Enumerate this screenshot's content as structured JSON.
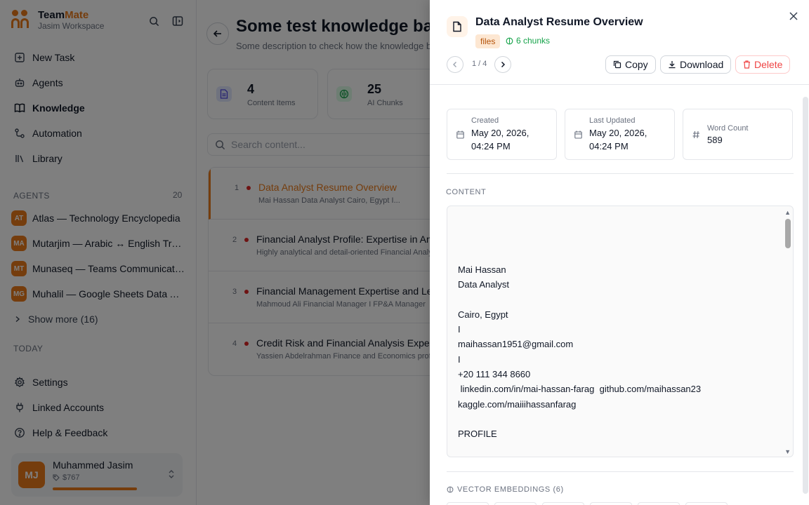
{
  "brand": {
    "name_part1": "Team",
    "name_part2": "Mate",
    "workspace": "Jasim Workspace",
    "accent": "#ea7a1a"
  },
  "nav": [
    {
      "label": "New Task",
      "icon": "new-task-icon"
    },
    {
      "label": "Agents",
      "icon": "agents-icon"
    },
    {
      "label": "Knowledge",
      "icon": "book-icon",
      "active": true
    },
    {
      "label": "Automation",
      "icon": "automation-icon"
    },
    {
      "label": "Library",
      "icon": "library-icon"
    }
  ],
  "agents_section": {
    "label": "AGENTS",
    "count": "20",
    "items": [
      {
        "initials": "AT",
        "name": "Atlas — Technology Encyclopedia"
      },
      {
        "initials": "MA",
        "name": "Mutarjim — Arabic ↔ English Translator"
      },
      {
        "initials": "MT",
        "name": "Munaseq — Teams Communication"
      },
      {
        "initials": "MG",
        "name": "Muhalil — Google Sheets Data Analyst"
      }
    ],
    "show_more": "Show more (16)"
  },
  "today_label": "TODAY",
  "bottom_nav": [
    {
      "label": "Settings",
      "icon": "gear-icon"
    },
    {
      "label": "Linked Accounts",
      "icon": "plug-icon"
    },
    {
      "label": "Help & Feedback",
      "icon": "help-icon"
    }
  ],
  "user": {
    "initials": "MJ",
    "name": "Muhammed Jasim",
    "credit": "$767"
  },
  "page": {
    "title": "Some test knowledge base",
    "description": "Some description to check how the knowledge base"
  },
  "stats": [
    {
      "value": "4",
      "label": "Content Items"
    },
    {
      "value": "25",
      "label": "AI Chunks"
    }
  ],
  "search": {
    "placeholder": "Search content..."
  },
  "items": [
    {
      "num": "1",
      "title": "Data Analyst Resume Overview",
      "sub": "Mai Hassan Data Analyst Cairo, Egypt I..."
    },
    {
      "num": "2",
      "title": "Financial Analyst Profile: Expertise in Analysis",
      "sub": "Highly analytical and detail-oriented Financial Analyst"
    },
    {
      "num": "3",
      "title": "Financial Management Expertise and Leadership",
      "sub": "Mahmoud Ali Financial Manager I FP&A Manager"
    },
    {
      "num": "4",
      "title": "Credit Risk and Financial Analysis Expertise",
      "sub": "Yassien Abdelrahman Finance and Economics professional"
    }
  ],
  "drawer": {
    "title": "Data Analyst Resume Overview",
    "tag": "files",
    "chunks": "6 chunks",
    "pager": "1 / 4",
    "copy": "Copy",
    "download": "Download",
    "delete": "Delete",
    "created_label": "Created",
    "created_value": "May 20, 2026, 04:24 PM",
    "updated_label": "Last Updated",
    "updated_value": "May 20, 2026, 04:24 PM",
    "wordcount_label": "Word Count",
    "wordcount_value": "589",
    "content_label": "CONTENT",
    "content_lines": [
      "Mai Hassan",
      "Data Analyst",
      "",
      "Cairo, Egypt",
      "I",
      "maihassan1951@gmail.com",
      "I",
      "+20 111 344 8660",
      " linkedin.com/in/mai-hassan-farag  github.com/maihassan23",
      "kaggle.com/maiiihassanfarag",
      "",
      "PROFILE"
    ],
    "embeddings_label": "VECTOR EMBEDDINGS (6)"
  }
}
